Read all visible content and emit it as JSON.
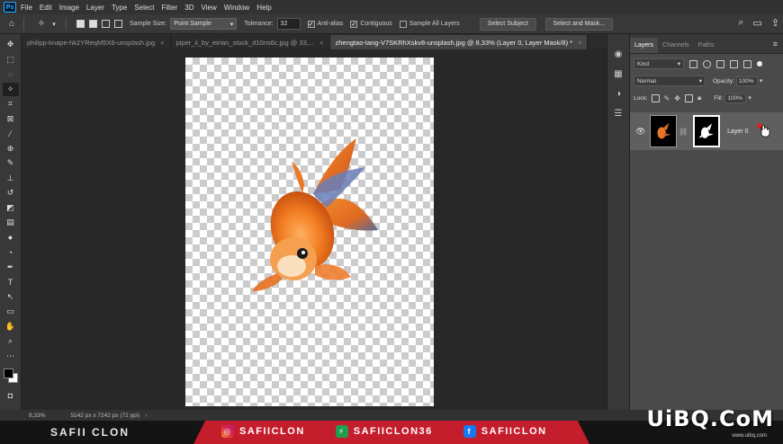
{
  "app": {
    "logo": "Ps"
  },
  "menu": [
    "File",
    "Edit",
    "Image",
    "Layer",
    "Type",
    "Select",
    "Filter",
    "3D",
    "View",
    "Window",
    "Help"
  ],
  "options": {
    "sample_size_label": "Sample Size:",
    "sample_size_value": "Point Sample",
    "tolerance_label": "Tolerance:",
    "tolerance_value": "32",
    "anti_alias_label": "Anti-alias",
    "anti_alias_checked": true,
    "contiguous_label": "Contiguous",
    "contiguous_checked": true,
    "sample_all_layers_label": "Sample All Layers",
    "sample_all_layers_checked": false,
    "select_subject_label": "Select Subject",
    "select_and_mask_label": "Select and Mask..."
  },
  "tabs": [
    {
      "label": "philipp-knape-hk2YReqM5X8-unsplash.jpg",
      "active": false
    },
    {
      "label": "piper_ii_by_eirian_stock_d10ns6c.jpg @ 33,...",
      "active": false
    },
    {
      "label": "zhengtao-tang-V7SKRhXskv8-unsplash.jpg @ 8,33% (Layer 0, Layer Mask/8) *",
      "active": true
    }
  ],
  "layers_panel": {
    "tabs": [
      "Layers",
      "Channels",
      "Paths"
    ],
    "filter_kind": "Kind",
    "blend_mode": "Normal",
    "opacity_label": "Opacity:",
    "opacity_value": "100%",
    "lock_label": "Lock:",
    "fill_label": "Fill:",
    "fill_value": "100%",
    "layers": [
      {
        "name": "Layer 0",
        "visible": true,
        "has_mask": true
      }
    ]
  },
  "status": {
    "zoom": "8,33%",
    "dimensions": "5142 px x 7242 px (72 ppi)"
  },
  "banner": {
    "left_text": "SAFII CLON",
    "socials": [
      {
        "icon": "instagram-icon",
        "handle": "SAFIICLON"
      },
      {
        "icon": "stacks-icon",
        "handle": "SAFIICLON36"
      },
      {
        "icon": "facebook-icon",
        "handle": "SAFIICLON"
      }
    ]
  },
  "watermark": {
    "text": "UiBQ.CoM",
    "sub": "www.uibq.com"
  },
  "colors": {
    "accent": "#31a8ff",
    "banner_red": "#c41d2b",
    "foreground": "#000000",
    "background": "#ffffff"
  }
}
